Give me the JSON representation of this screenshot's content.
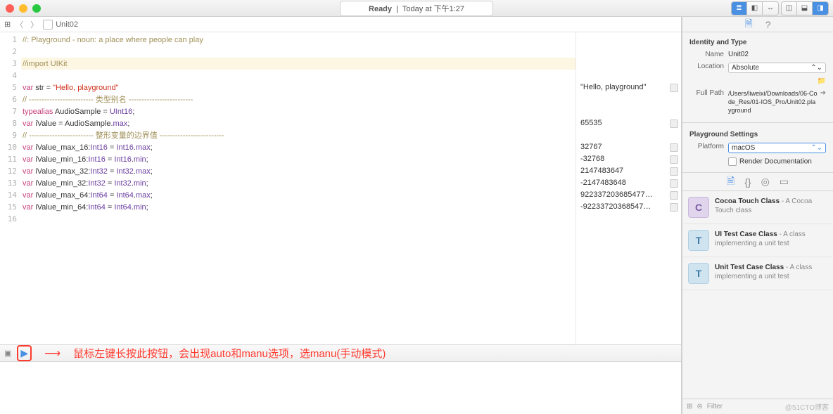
{
  "titlebar": {
    "status": "Ready",
    "time": "Today at 下午1:27"
  },
  "jumpbar": {
    "file": "Unit02"
  },
  "code": {
    "lines": [
      {
        "n": 1,
        "segs": [
          [
            "//: Playground - noun: a place where people can play",
            "c-comment"
          ]
        ],
        "result": ""
      },
      {
        "n": 2,
        "segs": [],
        "result": ""
      },
      {
        "n": 3,
        "segs": [
          [
            "//import UIKit",
            "c-comment"
          ]
        ],
        "result": "",
        "hl": true
      },
      {
        "n": 4,
        "segs": [],
        "result": ""
      },
      {
        "n": 5,
        "segs": [
          [
            "var ",
            "c-key"
          ],
          [
            "str = ",
            ""
          ],
          [
            "\"Hello, playground\"",
            "c-str"
          ]
        ],
        "result": "\"Hello, playground\""
      },
      {
        "n": 6,
        "segs": [
          [
            "// ------------------------- 类型别名 -------------------------",
            "c-comment"
          ]
        ],
        "result": ""
      },
      {
        "n": 7,
        "segs": [
          [
            "typealias ",
            "c-key"
          ],
          [
            "AudioSample = ",
            ""
          ],
          [
            "UInt16",
            "c-type"
          ],
          [
            ";",
            ""
          ]
        ],
        "result": ""
      },
      {
        "n": 8,
        "segs": [
          [
            "var ",
            "c-key"
          ],
          [
            "iValue = AudioSample.",
            ""
          ],
          [
            "max",
            "c-prop"
          ],
          [
            ";",
            ""
          ]
        ],
        "result": "65535"
      },
      {
        "n": 9,
        "segs": [
          [
            "// ------------------------- 整形变量的边界值 -------------------------",
            "c-comment"
          ]
        ],
        "result": ""
      },
      {
        "n": 10,
        "segs": [
          [
            "var ",
            "c-key"
          ],
          [
            "iValue_max_16:",
            ""
          ],
          [
            "Int16",
            "c-type"
          ],
          [
            " = ",
            ""
          ],
          [
            "Int16",
            "c-type"
          ],
          [
            ".",
            ""
          ],
          [
            "max",
            "c-prop"
          ],
          [
            ";",
            ""
          ]
        ],
        "result": "32767"
      },
      {
        "n": 11,
        "segs": [
          [
            "var ",
            "c-key"
          ],
          [
            "iValue_min_16:",
            ""
          ],
          [
            "Int16",
            "c-type"
          ],
          [
            " = ",
            ""
          ],
          [
            "Int16",
            "c-type"
          ],
          [
            ".",
            ""
          ],
          [
            "min",
            "c-prop"
          ],
          [
            ";",
            ""
          ]
        ],
        "result": "-32768"
      },
      {
        "n": 12,
        "segs": [
          [
            "var ",
            "c-key"
          ],
          [
            "iValue_max_32:",
            ""
          ],
          [
            "Int32",
            "c-type"
          ],
          [
            " = ",
            ""
          ],
          [
            "Int32",
            "c-type"
          ],
          [
            ".",
            ""
          ],
          [
            "max",
            "c-prop"
          ],
          [
            ";",
            ""
          ]
        ],
        "result": "2147483647"
      },
      {
        "n": 13,
        "segs": [
          [
            "var ",
            "c-key"
          ],
          [
            "iValue_min_32:",
            ""
          ],
          [
            "Int32",
            "c-type"
          ],
          [
            " = ",
            ""
          ],
          [
            "Int32",
            "c-type"
          ],
          [
            ".",
            ""
          ],
          [
            "min",
            "c-prop"
          ],
          [
            ";",
            ""
          ]
        ],
        "result": "-2147483648"
      },
      {
        "n": 14,
        "segs": [
          [
            "var ",
            "c-key"
          ],
          [
            "iValue_max_64:",
            ""
          ],
          [
            "Int64",
            "c-type"
          ],
          [
            " = ",
            ""
          ],
          [
            "Int64",
            "c-type"
          ],
          [
            ".",
            ""
          ],
          [
            "max",
            "c-prop"
          ],
          [
            ";",
            ""
          ]
        ],
        "result": "922337203685477…"
      },
      {
        "n": 15,
        "segs": [
          [
            "var ",
            "c-key"
          ],
          [
            "iValue_min_64:",
            ""
          ],
          [
            "Int64",
            "c-type"
          ],
          [
            " = ",
            ""
          ],
          [
            "Int64",
            "c-type"
          ],
          [
            ".",
            ""
          ],
          [
            "min",
            "c-prop"
          ],
          [
            ";",
            ""
          ]
        ],
        "result": "-92233720368547…"
      },
      {
        "n": 16,
        "segs": [],
        "result": ""
      }
    ]
  },
  "annotation": "鼠标左键长按此按钮，会出现auto和manu选项，选manu(手动模式)",
  "inspector": {
    "identity_header": "Identity and Type",
    "name_label": "Name",
    "name_value": "Unit02",
    "location_label": "Location",
    "location_value": "Absolute",
    "fullpath_label": "Full Path",
    "fullpath_value": "/Users/liweixi/Downloads/06-Code_Res/01-IOS_Pro/Unit02.playground",
    "settings_header": "Playground Settings",
    "platform_label": "Platform",
    "platform_value": "macOS",
    "render_label": "Render Documentation"
  },
  "library": {
    "items": [
      {
        "icon": "C",
        "cls": "c",
        "title": "Cocoa Touch Class",
        "desc": " - A Cocoa Touch class"
      },
      {
        "icon": "T",
        "cls": "t",
        "title": "UI Test Case Class",
        "desc": " - A class implementing a unit test"
      },
      {
        "icon": "T",
        "cls": "t",
        "title": "Unit Test Case Class",
        "desc": " - A class implementing a unit test"
      }
    ],
    "filter": "Filter"
  },
  "watermark": "@51CTO博客"
}
